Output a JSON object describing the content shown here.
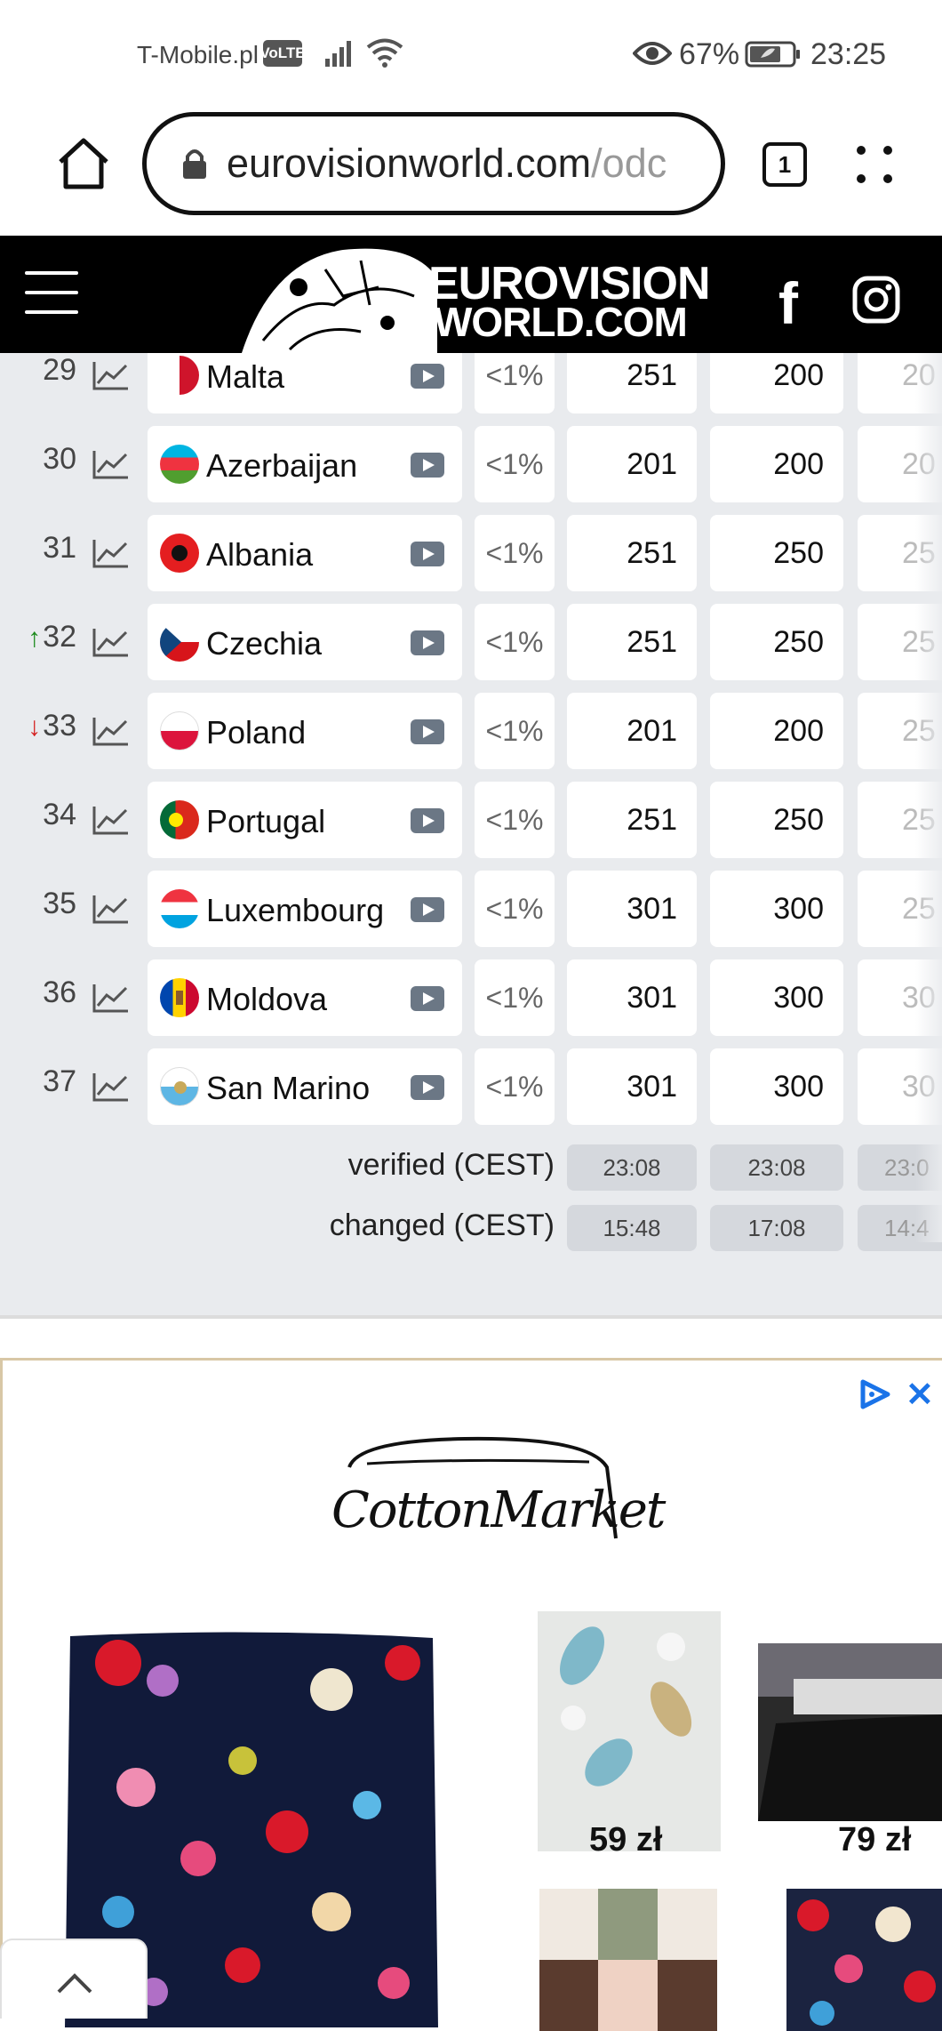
{
  "status_bar": {
    "carrier": "T-Mobile.pl",
    "volte": "VoLTE",
    "battery": "67%",
    "time": "23:25"
  },
  "browser": {
    "url_host": "eurovisionworld.com",
    "url_path": "/odc",
    "tab_count": "1"
  },
  "site": {
    "logo_line1": "EUROVISION",
    "logo_line2": "WORLD.COM",
    "facebook": "f"
  },
  "rows": [
    {
      "rank": "29",
      "move": "",
      "country": "Malta",
      "pct": "<1%",
      "odd1": "251",
      "odd2": "200",
      "odd3": "20"
    },
    {
      "rank": "30",
      "move": "",
      "country": "Azerbaijan",
      "pct": "<1%",
      "odd1": "201",
      "odd2": "200",
      "odd3": "20"
    },
    {
      "rank": "31",
      "move": "",
      "country": "Albania",
      "pct": "<1%",
      "odd1": "251",
      "odd2": "250",
      "odd3": "25"
    },
    {
      "rank": "32",
      "move": "up",
      "country": "Czechia",
      "pct": "<1%",
      "odd1": "251",
      "odd2": "250",
      "odd3": "25"
    },
    {
      "rank": "33",
      "move": "down",
      "country": "Poland",
      "pct": "<1%",
      "odd1": "201",
      "odd2": "200",
      "odd3": "25"
    },
    {
      "rank": "34",
      "move": "",
      "country": "Portugal",
      "pct": "<1%",
      "odd1": "251",
      "odd2": "250",
      "odd3": "25"
    },
    {
      "rank": "35",
      "move": "",
      "country": "Luxembourg",
      "pct": "<1%",
      "odd1": "301",
      "odd2": "300",
      "odd3": "25"
    },
    {
      "rank": "36",
      "move": "",
      "country": "Moldova",
      "pct": "<1%",
      "odd1": "301",
      "odd2": "300",
      "odd3": "30"
    },
    {
      "rank": "37",
      "move": "",
      "country": "San Marino",
      "pct": "<1%",
      "odd1": "301",
      "odd2": "300",
      "odd3": "30"
    }
  ],
  "meta": {
    "verified_label": "verified (CEST)",
    "verified": [
      "23:08",
      "23:08",
      "23:0"
    ],
    "changed_label": "changed (CEST)",
    "changed": [
      "15:48",
      "17:08",
      "14:4"
    ]
  },
  "ad": {
    "brand": "CottonMarket",
    "close": "✕",
    "price1": "59 zł",
    "price2": "79 zł"
  }
}
